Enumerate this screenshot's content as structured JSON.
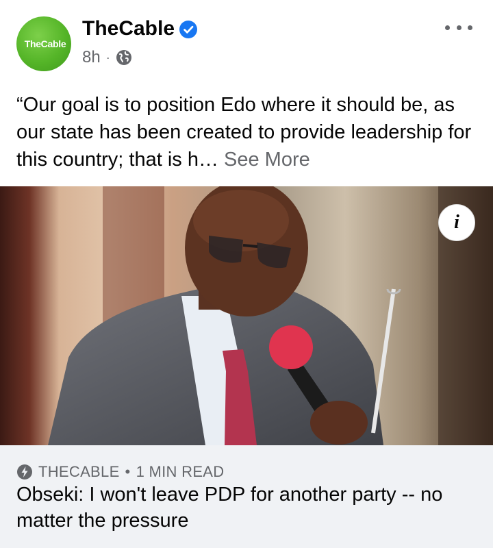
{
  "post": {
    "page_name": "TheCable",
    "avatar_text": "TheCable",
    "time": "8h",
    "text": "“Our goal is to position Edo where it should be, as our state has been created to provide leadership for this country; that is h… ",
    "see_more": "See More"
  },
  "link": {
    "source": "THECABLE",
    "separator": "•",
    "read_time": "1 MIN READ",
    "title": "Obseki: I won't leave PDP for another party -- no matter the pressure"
  },
  "icons": {
    "verified": "verified-badge-icon",
    "privacy": "globe-icon",
    "more": "more-options-icon",
    "info": "info-icon",
    "instant": "lightning-bolt-icon"
  },
  "colors": {
    "brand_green": "#55b528",
    "verified_blue": "#1877f2",
    "secondary_text": "#65676b",
    "preview_bg": "#f0f2f5"
  },
  "ui": {
    "meta_dot": "·",
    "info_glyph": "i"
  }
}
